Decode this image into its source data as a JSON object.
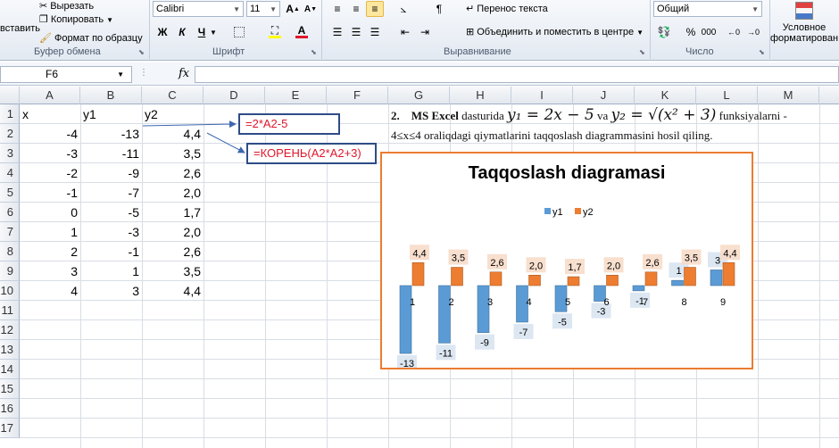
{
  "ribbon": {
    "clipboard": {
      "paste_label": "вставить",
      "cut_label": "Вырезать",
      "copy_label": "Копировать",
      "format_painter_label": "Формат по образцу",
      "group_label": "Буфер обмена"
    },
    "font": {
      "font_name": "Calibri",
      "font_size": "11",
      "bold": "Ж",
      "italic": "К",
      "underline": "Ч",
      "group_label": "Шрифт",
      "fill_color": "#ffff00",
      "font_color": "#e0162b"
    },
    "alignment": {
      "wrap_text_label": "Перенос текста",
      "merge_center_label": "Объединить и поместить в центре",
      "group_label": "Выравнивание"
    },
    "number": {
      "format_value": "Общий",
      "percent": "%",
      "thousands": "000",
      "group_label": "Число"
    },
    "styles": {
      "conditional_label_1": "Условное",
      "conditional_label_2": "форматирован"
    }
  },
  "formula_bar": {
    "name_box": "F6",
    "fx": "fx",
    "value": ""
  },
  "grid": {
    "columns": [
      "A",
      "B",
      "C",
      "D",
      "E",
      "F",
      "G",
      "H",
      "I",
      "J",
      "K",
      "L",
      "M"
    ],
    "rows": [
      "1",
      "2",
      "3",
      "4",
      "5",
      "6",
      "7",
      "8",
      "9",
      "10",
      "11",
      "12",
      "13",
      "14",
      "15",
      "16",
      "17"
    ],
    "headers": {
      "a1": "x",
      "b1": "y1",
      "c1": "y2"
    },
    "x": [
      "-4",
      "-3",
      "-2",
      "-1",
      "0",
      "1",
      "2",
      "3",
      "4"
    ],
    "y1": [
      "-13",
      "-11",
      "-9",
      "-7",
      "-5",
      "-3",
      "-1",
      "1",
      "3"
    ],
    "y2": [
      "4,4",
      "3,5",
      "2,6",
      "2,0",
      "1,7",
      "2,0",
      "2,6",
      "3,5",
      "4,4"
    ]
  },
  "callouts": {
    "formula_y1": "=2*A2-5",
    "formula_y2": "=КОРЕНЬ(A2*A2+3)"
  },
  "task": {
    "number": "2.",
    "app_name": "MS Excel",
    "text1": "dasturida",
    "eq1": "y₁ = 2x − 5",
    "conj": "va",
    "eq2": "y₂ = √(x² + 3)",
    "text2": "funksiyalarni -",
    "line2": "4≤x≤4 oraliqdagi qiymatlarini taqqoslash diagrammasini hosil qiling."
  },
  "chart_data": {
    "type": "bar",
    "title": "Taqqoslash diagramasi",
    "categories": [
      "1",
      "2",
      "3",
      "4",
      "5",
      "6",
      "7",
      "8",
      "9"
    ],
    "series": [
      {
        "name": "y1",
        "color": "#5b9bd5",
        "values": [
          -13,
          -11,
          -9,
          -7,
          -5,
          -3,
          -1,
          1,
          3
        ],
        "labels": [
          "-13",
          "-11",
          "-9",
          "-7",
          "-5",
          "-3",
          "-1",
          "1",
          "3"
        ]
      },
      {
        "name": "y2",
        "color": "#ed7d31",
        "values": [
          4.4,
          3.5,
          2.6,
          2.0,
          1.7,
          2.0,
          2.6,
          3.5,
          4.4
        ],
        "labels": [
          "4,4",
          "3,5",
          "2,6",
          "2,0",
          "1,7",
          "2,0",
          "2,6",
          "3,5",
          "4,4"
        ]
      }
    ],
    "ylim": [
      -13,
      4.4
    ],
    "legend": "top",
    "grid": false
  }
}
